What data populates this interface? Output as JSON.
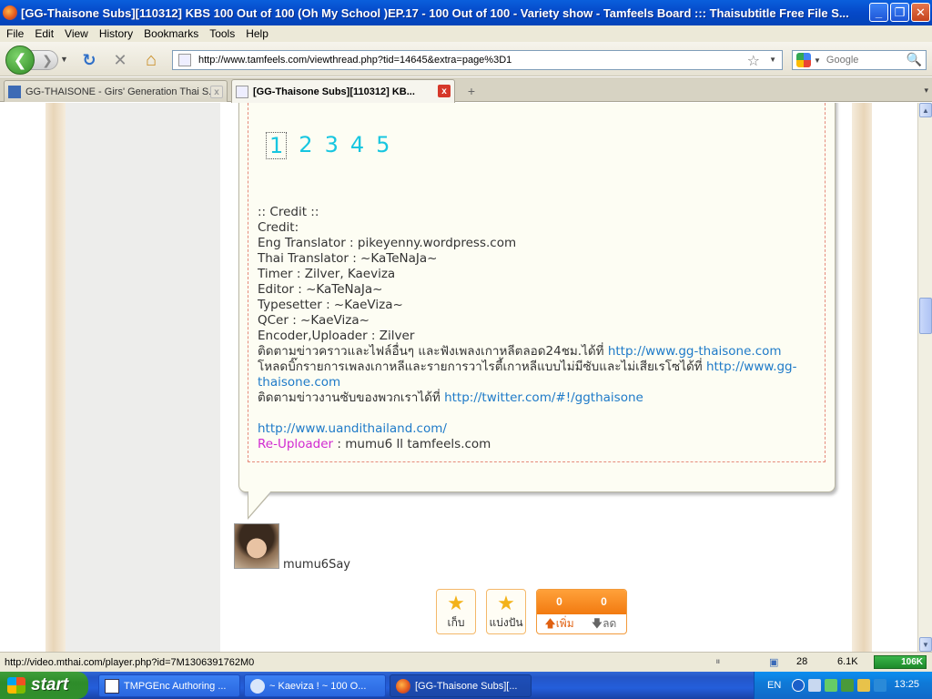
{
  "window": {
    "title": "[GG-Thaisone Subs][110312] KBS 100 Out of 100 (Oh My School )EP.17 - 100 Out of 100 - Variety show - Tamfeels Board ::: Thaisubtitle Free File S...",
    "minimize": "_",
    "maximize": "❐",
    "close": "✕"
  },
  "menu": {
    "items": [
      "File",
      "Edit",
      "View",
      "History",
      "Bookmarks",
      "Tools",
      "Help"
    ]
  },
  "nav": {
    "url": "http://www.tamfeels.com/viewthread.php?tid=14645&extra=page%3D1",
    "search_placeholder": "Google",
    "back_glyph": "❮",
    "forward_glyph": "❯",
    "reload_glyph": "↻",
    "stop_glyph": "✕",
    "home_glyph": "⌂",
    "bookmark_glyph": "☆",
    "search_glyph": "🔍"
  },
  "tabs": [
    {
      "label": "GG-THAISONE - Girs' Generation Thai S...",
      "active": false
    },
    {
      "label": "[GG-Thaisone Subs][110312] KB...",
      "active": true
    }
  ],
  "tab_controls": {
    "new_tab": "+",
    "close": "x",
    "list": "▾"
  },
  "post": {
    "page_numbers": [
      "1",
      "2",
      "3",
      "4",
      "5"
    ],
    "credits_lines": [
      ":: Credit ::",
      "Credit:",
      "Eng Translator : pikeyenny.wordpress.com",
      "Thai Translator : ~KaTeNaJa~",
      "Timer : Zilver, Kaeviza",
      "Editor : ~KaTeNaJa~",
      "Typesetter : ~KaeViza~",
      "QCer : ~KaeViza~",
      "Encoder,Uploader : Zilver"
    ],
    "follow_text": "ติดตามข่าวคราวและไฟล์อื่นๆ และฟังเพลงเกาหลีตลอด24ชม.ได้ที่ ",
    "follow_link": "http://www.gg-thaisone.com",
    "download_text": "โหลดบิ๊กรายการเพลงเกาหลีและรายการวาไรตี้เกาหลีแบบไม่มีซับและไม่เสียเรโซได้ที่ ",
    "download_link": "http://www.gg-thaisone.com",
    "twitter_text": "ติดตามข่าวงานซับของพวกเราได้ที่ ",
    "twitter_link": "http://twitter.com/#!/ggthaisone",
    "uandi_link": "http://www.uandithailand.com/",
    "reuploader_label": "Re-Uploader",
    "reuploader_value": " : mumu6 ll tamfeels.com",
    "author": "mumu6Say"
  },
  "actions": {
    "save_label": "เก็บ",
    "share_label": "แบ่งปัน",
    "vote_up_count": "0",
    "vote_down_count": "0",
    "vote_up_label": "เพิ่ม",
    "vote_down_label": "ลด"
  },
  "status": {
    "url": "http://video.mthai.com/player.php?id=7M1306391762M0",
    "count": "28",
    "size": "6.1K",
    "net": "106K"
  },
  "taskbar": {
    "start_label": "start",
    "items": [
      {
        "label": "TMPGEnc Authoring ...",
        "active": false
      },
      {
        "label": "~ Kaeviza ! ~ 100 O...",
        "active": false
      },
      {
        "label": "[GG-Thaisone Subs][...",
        "active": true
      }
    ],
    "lang": "EN",
    "clock": "13:25"
  },
  "colors": {
    "titlebar": "#0548c8",
    "link": "#1e7ac8",
    "page_number": "#17c6e0",
    "reuploader": "#d12ad1",
    "vote_orange": "#f27a10"
  }
}
